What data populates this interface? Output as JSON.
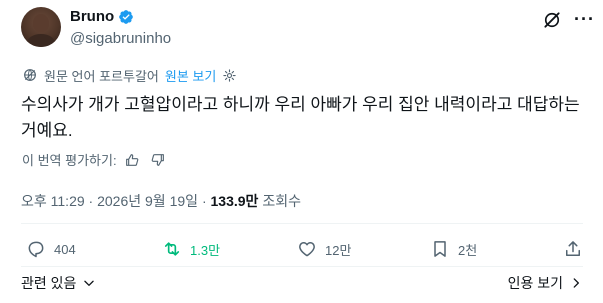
{
  "author": {
    "name": "Bruno",
    "handle": "@sigabruninho",
    "verified_color": "#1d9bf0"
  },
  "translation": {
    "label": "원문 언어 포르투갈어",
    "link": "원본 보기"
  },
  "tweet": {
    "text": "수의사가 개가 고혈압이라고 하니까 우리 아빠가 우리 집안 내력이라고 대답하는 거예요."
  },
  "rate": {
    "label": "이 번역 평가하기:"
  },
  "meta": {
    "time": "오후 11:29",
    "date": "2026년 9월 19일",
    "views_count": "133.9만",
    "views_label": "조회수"
  },
  "actions": {
    "replies": "404",
    "reposts": "1.3만",
    "likes": "12만",
    "bookmarks": "2천",
    "repost_color": "#00ba7c"
  },
  "footer": {
    "related": "관련 있음",
    "quotes": "인용 보기"
  }
}
